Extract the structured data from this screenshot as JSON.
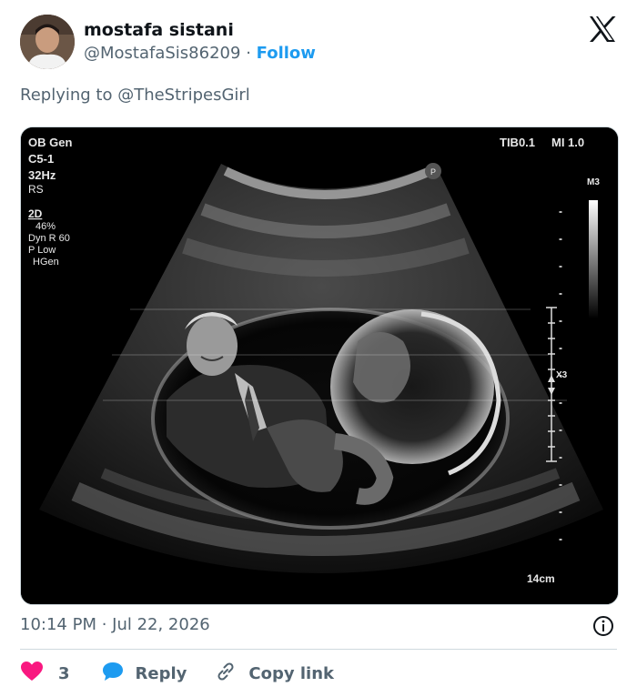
{
  "author": {
    "name": "mostafa sistani",
    "handle": "@MostafaSis86209",
    "separator": "·",
    "follow_label": "Follow"
  },
  "reply_context": {
    "prefix": "Replying to ",
    "mention": "@TheStripesGirl"
  },
  "ultrasound": {
    "exam": "OB Gen",
    "probe": "C5-1",
    "frequency": "32Hz",
    "mode_rs": "RS",
    "mode_2d": "2D",
    "gain": "46%",
    "dyn_range": "Dyn R 60",
    "power": "P Low",
    "harmonic": "HGen",
    "tib": "TIB0.1",
    "mi": "MI 1.0",
    "map": "M3",
    "zoom": "X3",
    "depth": "14cm",
    "marker_p": "P"
  },
  "meta": {
    "timestamp": "10:14 PM · Jul 22, 2026"
  },
  "actions": {
    "like_count": "3",
    "reply_label": "Reply",
    "copy_label": "Copy link"
  },
  "colors": {
    "like": "#f91880",
    "reply": "#1d9bf0",
    "link": "#1d9bf0",
    "muted": "#536471"
  }
}
